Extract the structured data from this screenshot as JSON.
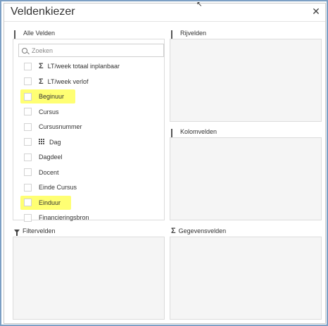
{
  "dialog": {
    "title": "Veldenkiezer",
    "close_icon": "close-icon"
  },
  "all_fields": {
    "header": "Alle Velden",
    "search_placeholder": "Zoeken",
    "items": [
      {
        "label": "LT/week totaal inplanbaar",
        "icon": "sigma-icon",
        "highlighted": false,
        "checked": false
      },
      {
        "label": "LT/week verlof",
        "icon": "sigma-icon",
        "highlighted": false,
        "checked": false
      },
      {
        "label": "Beginuur",
        "icon": "",
        "highlighted": true,
        "checked": false
      },
      {
        "label": "Cursus",
        "icon": "",
        "highlighted": false,
        "checked": false
      },
      {
        "label": "Cursusnummer",
        "icon": "",
        "highlighted": false,
        "checked": false
      },
      {
        "label": "Dag",
        "icon": "grid-icon",
        "highlighted": false,
        "checked": false
      },
      {
        "label": "Dagdeel",
        "icon": "",
        "highlighted": false,
        "checked": false
      },
      {
        "label": "Docent",
        "icon": "",
        "highlighted": false,
        "checked": false
      },
      {
        "label": "Einde Cursus",
        "icon": "",
        "highlighted": false,
        "checked": false
      },
      {
        "label": "Einduur",
        "icon": "",
        "highlighted": true,
        "checked": false
      },
      {
        "label": "Financieringsbron",
        "icon": "",
        "highlighted": false,
        "checked": false
      }
    ]
  },
  "rows_panel": {
    "header": "Rijvelden"
  },
  "columns_panel": {
    "header": "Kolomvelden"
  },
  "filters_panel": {
    "header": "Filtervelden"
  },
  "values_panel": {
    "header": "Gegevensvelden"
  },
  "colors": {
    "highlight": "#ffff00",
    "drop_zone": "#f5f5f5",
    "border": "#dcdcdc",
    "window_frame": "#7c9fc4"
  }
}
